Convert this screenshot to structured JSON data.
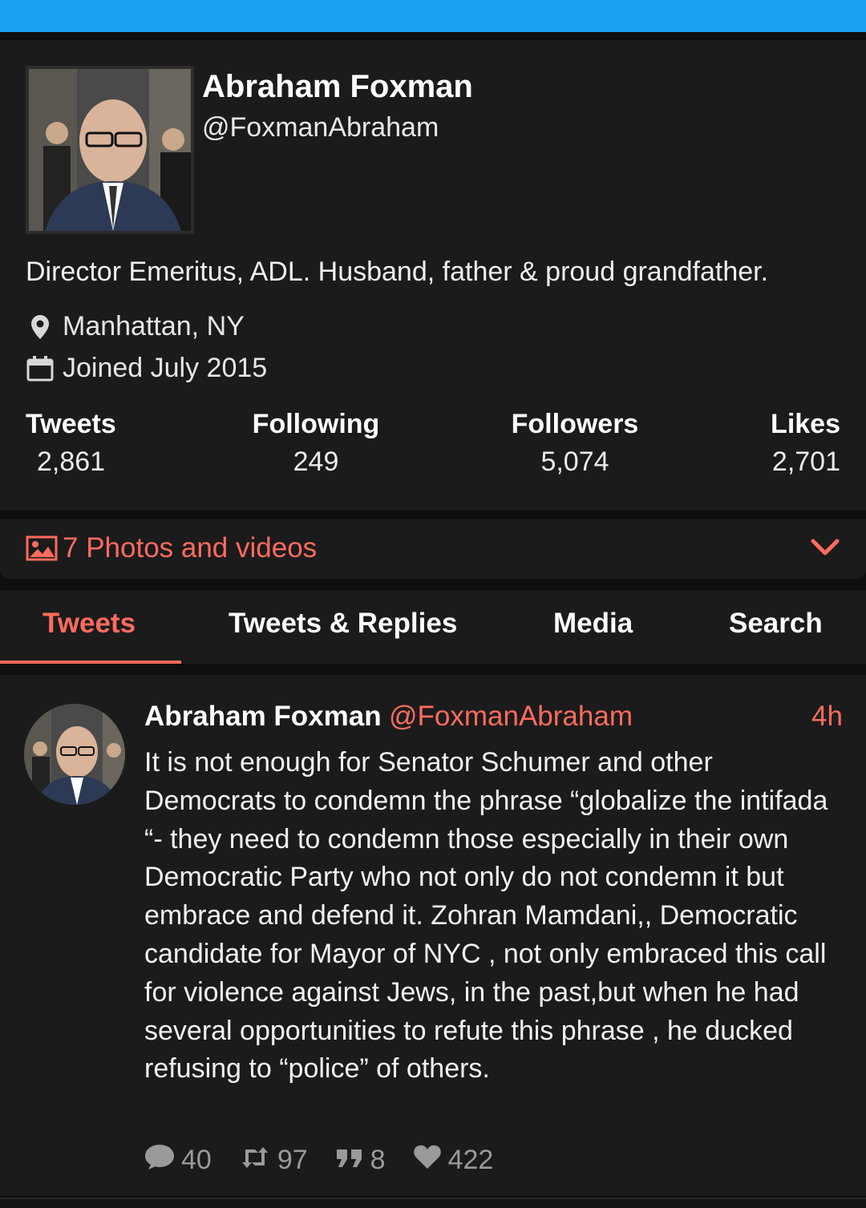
{
  "profile": {
    "fullname": "Abraham Foxman",
    "username": "@FoxmanAbraham",
    "bio": "Director Emeritus, ADL. Husband, father & proud grandfather.",
    "location": "Manhattan, NY",
    "joined": "Joined July 2015",
    "stats": [
      {
        "label": "Tweets",
        "value": "2,861"
      },
      {
        "label": "Following",
        "value": "249"
      },
      {
        "label": "Followers",
        "value": "5,074"
      },
      {
        "label": "Likes",
        "value": "2,701"
      }
    ]
  },
  "photos": {
    "label": "7 Photos and videos"
  },
  "tabs": [
    {
      "label": "Tweets"
    },
    {
      "label": "Tweets & Replies"
    },
    {
      "label": "Media"
    },
    {
      "label": "Search"
    }
  ],
  "tweet": {
    "name": "Abraham Foxman",
    "handle": "@FoxmanAbraham",
    "time": "4h",
    "text": "It is not enough for Senator Schumer and other Democrats to condemn the phrase “globalize the intifada “- they need to condemn those especially in their own Democratic Party who not only do not condemn it but embrace and defend it. Zohran Mamdani,, Democratic candidate for Mayor of NYC , not only embraced this call for violence against Jews, in the past,but when he had several opportunities to refute this phrase , he ducked refusing to “police” of others.",
    "replies": "40",
    "retweets": "97",
    "quotes": "8",
    "likes": "422"
  },
  "colors": {
    "accent": "#ff6b5e",
    "topbar": "#1da1f2",
    "card": "#1b1b1b"
  }
}
